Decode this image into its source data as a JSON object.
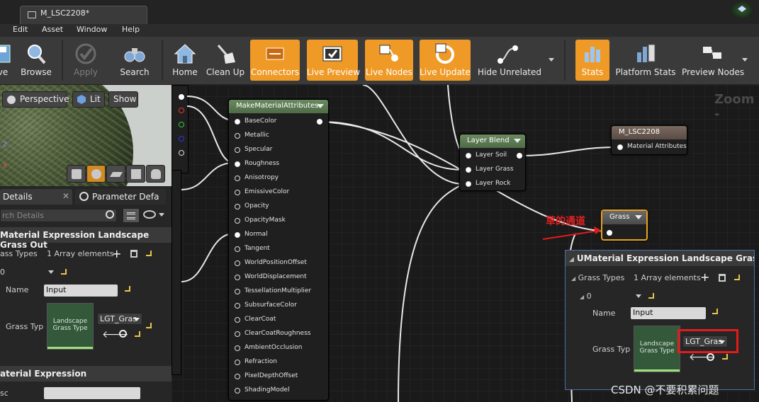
{
  "window": {
    "tab_title": "M_LSC2208*"
  },
  "menu": [
    "Edit",
    "Asset",
    "Window",
    "Help"
  ],
  "toolbar": [
    {
      "label": "ve",
      "icon": "save-icon",
      "active": false
    },
    {
      "label": "Browse",
      "icon": "browse-icon",
      "active": false
    },
    {
      "label": "Apply",
      "icon": "apply-check-icon",
      "active": false,
      "disabled": true
    },
    {
      "label": "Search",
      "icon": "binoculars-icon",
      "active": false
    },
    {
      "label": "Home",
      "icon": "home-icon",
      "active": false
    },
    {
      "label": "Clean Up",
      "icon": "broom-icon",
      "active": false
    },
    {
      "label": "Connectors",
      "icon": "connectors-icon",
      "active": true
    },
    {
      "label": "Live Preview",
      "icon": "tv-icon",
      "active": true
    },
    {
      "label": "Live Nodes",
      "icon": "live-nodes-icon",
      "active": true
    },
    {
      "label": "Live Update",
      "icon": "refresh-icon",
      "active": true
    },
    {
      "label": "Hide Unrelated",
      "icon": "graph-icon",
      "active": false
    },
    {
      "label": "Stats",
      "icon": "stats-icon",
      "active": true
    },
    {
      "label": "Platform Stats",
      "icon": "platform-stats-icon",
      "active": false
    },
    {
      "label": "Preview Nodes",
      "icon": "preview-nodes-icon",
      "active": false
    }
  ],
  "viewport": {
    "perspective": "Perspective",
    "lit": "Lit",
    "show": "Show"
  },
  "details": {
    "tab_details": "Details",
    "tab_params": "Parameter Defa",
    "search_placeholder": "rch Details",
    "section_title": "Material Expression Landscape Grass Out",
    "grass_types_label": "ass Types",
    "grass_types_value": "1 Array elements",
    "index": "0",
    "name_label": "Name",
    "name_value": "Input",
    "grass_type_label": "Grass Typ",
    "thumb_text": "Landscape Grass Type",
    "asset_value": "LGT_Gras",
    "section2_title": "aterial Expression",
    "desc_label": "sc"
  },
  "graph": {
    "zoom_text": "Zoom -",
    "make_node": {
      "title": "MakeMaterialAttributes",
      "pins": [
        "BaseColor",
        "Metallic",
        "Specular",
        "Roughness",
        "Anisotropy",
        "EmissiveColor",
        "Opacity",
        "OpacityMask",
        "Normal",
        "Tangent",
        "WorldPositionOffset",
        "WorldDisplacement",
        "TessellationMultiplier",
        "SubsurfaceColor",
        "ClearCoat",
        "ClearCoatRoughness",
        "AmbientOcclusion",
        "Refraction",
        "PixelDepthOffset",
        "ShadingModel"
      ]
    },
    "layer_blend": {
      "title": "Layer Blend",
      "pins": [
        "Layer Soil",
        "Layer Grass",
        "Layer Rock"
      ]
    },
    "output_node": {
      "title": "M_LSC2208",
      "pin": "Material Attributes"
    },
    "grass_node": {
      "title": "Grass"
    },
    "annotation": "草的通道",
    "panel": {
      "title": "UMaterial Expression Landscape Grass Ou",
      "grass_types_label": "Grass Types",
      "grass_types_value": "1 Array elements",
      "index": "0",
      "name_label": "Name",
      "name_value": "Input",
      "grass_type_label": "Grass Typ",
      "thumb_text": "Landscape Grass Type",
      "asset_value": "LGT_Gras"
    },
    "watermark": "CSDN @不要积累问题"
  },
  "colors": {
    "accent": "#ef9a27",
    "annotation": "#e21b1b",
    "node_header_green": "#5a7a50"
  }
}
